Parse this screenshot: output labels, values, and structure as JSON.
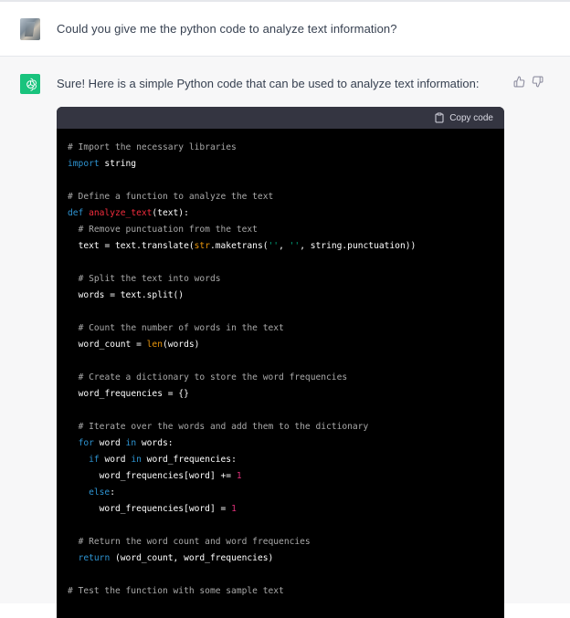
{
  "user_message": {
    "text": "Could you give me the python code to analyze text information?"
  },
  "assistant_message": {
    "text": "Sure! Here is a simple Python code that can be used to analyze text information:"
  },
  "code_block": {
    "copy_label": "Copy code",
    "lines": [
      {
        "indent": "",
        "tokens": [
          {
            "c": "cm",
            "t": "# Import the necessary libraries"
          }
        ]
      },
      {
        "indent": "",
        "tokens": [
          {
            "c": "kw",
            "t": "import"
          },
          {
            "c": "",
            "t": " string"
          }
        ]
      },
      {
        "indent": "",
        "tokens": []
      },
      {
        "indent": "",
        "tokens": [
          {
            "c": "cm",
            "t": "# Define a function to analyze the text"
          }
        ]
      },
      {
        "indent": "",
        "tokens": [
          {
            "c": "kw",
            "t": "def"
          },
          {
            "c": "",
            "t": " "
          },
          {
            "c": "fn",
            "t": "analyze_text"
          },
          {
            "c": "",
            "t": "(text):"
          }
        ]
      },
      {
        "indent": "  ",
        "tokens": [
          {
            "c": "cm",
            "t": "# Remove punctuation from the text"
          }
        ]
      },
      {
        "indent": "  ",
        "tokens": [
          {
            "c": "",
            "t": "text = text.translate("
          },
          {
            "c": "bi",
            "t": "str"
          },
          {
            "c": "",
            "t": ".maketrans("
          },
          {
            "c": "st",
            "t": "''"
          },
          {
            "c": "",
            "t": ", "
          },
          {
            "c": "st",
            "t": "''"
          },
          {
            "c": "",
            "t": ", string.punctuation))"
          }
        ]
      },
      {
        "indent": "",
        "tokens": []
      },
      {
        "indent": "  ",
        "tokens": [
          {
            "c": "cm",
            "t": "# Split the text into words"
          }
        ]
      },
      {
        "indent": "  ",
        "tokens": [
          {
            "c": "",
            "t": "words = text.split()"
          }
        ]
      },
      {
        "indent": "",
        "tokens": []
      },
      {
        "indent": "  ",
        "tokens": [
          {
            "c": "cm",
            "t": "# Count the number of words in the text"
          }
        ]
      },
      {
        "indent": "  ",
        "tokens": [
          {
            "c": "",
            "t": "word_count = "
          },
          {
            "c": "bi",
            "t": "len"
          },
          {
            "c": "",
            "t": "(words)"
          }
        ]
      },
      {
        "indent": "",
        "tokens": []
      },
      {
        "indent": "  ",
        "tokens": [
          {
            "c": "cm",
            "t": "# Create a dictionary to store the word frequencies"
          }
        ]
      },
      {
        "indent": "  ",
        "tokens": [
          {
            "c": "",
            "t": "word_frequencies = {}"
          }
        ]
      },
      {
        "indent": "",
        "tokens": []
      },
      {
        "indent": "  ",
        "tokens": [
          {
            "c": "cm",
            "t": "# Iterate over the words and add them to the dictionary"
          }
        ]
      },
      {
        "indent": "  ",
        "tokens": [
          {
            "c": "kw",
            "t": "for"
          },
          {
            "c": "",
            "t": " word "
          },
          {
            "c": "kw",
            "t": "in"
          },
          {
            "c": "",
            "t": " words:"
          }
        ]
      },
      {
        "indent": "    ",
        "tokens": [
          {
            "c": "kw",
            "t": "if"
          },
          {
            "c": "",
            "t": " word "
          },
          {
            "c": "kw",
            "t": "in"
          },
          {
            "c": "",
            "t": " word_frequencies:"
          }
        ]
      },
      {
        "indent": "      ",
        "tokens": [
          {
            "c": "",
            "t": "word_frequencies[word] += "
          },
          {
            "c": "num",
            "t": "1"
          }
        ]
      },
      {
        "indent": "    ",
        "tokens": [
          {
            "c": "kw",
            "t": "else"
          },
          {
            "c": "",
            "t": ":"
          }
        ]
      },
      {
        "indent": "      ",
        "tokens": [
          {
            "c": "",
            "t": "word_frequencies[word] = "
          },
          {
            "c": "num",
            "t": "1"
          }
        ]
      },
      {
        "indent": "",
        "tokens": []
      },
      {
        "indent": "  ",
        "tokens": [
          {
            "c": "cm",
            "t": "# Return the word count and word frequencies"
          }
        ]
      },
      {
        "indent": "  ",
        "tokens": [
          {
            "c": "kw",
            "t": "return"
          },
          {
            "c": "",
            "t": " (word_count, word_frequencies)"
          }
        ]
      },
      {
        "indent": "",
        "tokens": []
      },
      {
        "indent": "",
        "tokens": [
          {
            "c": "cm",
            "t": "# Test the function with some sample text"
          }
        ]
      }
    ]
  },
  "icons": {
    "assistant_avatar": "openai-logo-icon",
    "thumbs_up": "thumbs-up-icon",
    "thumbs_down": "thumbs-down-icon",
    "copy": "clipboard-icon"
  },
  "colors": {
    "assistant_avatar_bg": "#19c37d",
    "code_bg": "#000000",
    "code_header_bg": "#343541",
    "comment": "#a9a9a9",
    "keyword": "#2e95d3",
    "function_name": "#f22c3d",
    "builtin": "#e9950c",
    "number": "#df3079",
    "string": "#00a67d"
  }
}
